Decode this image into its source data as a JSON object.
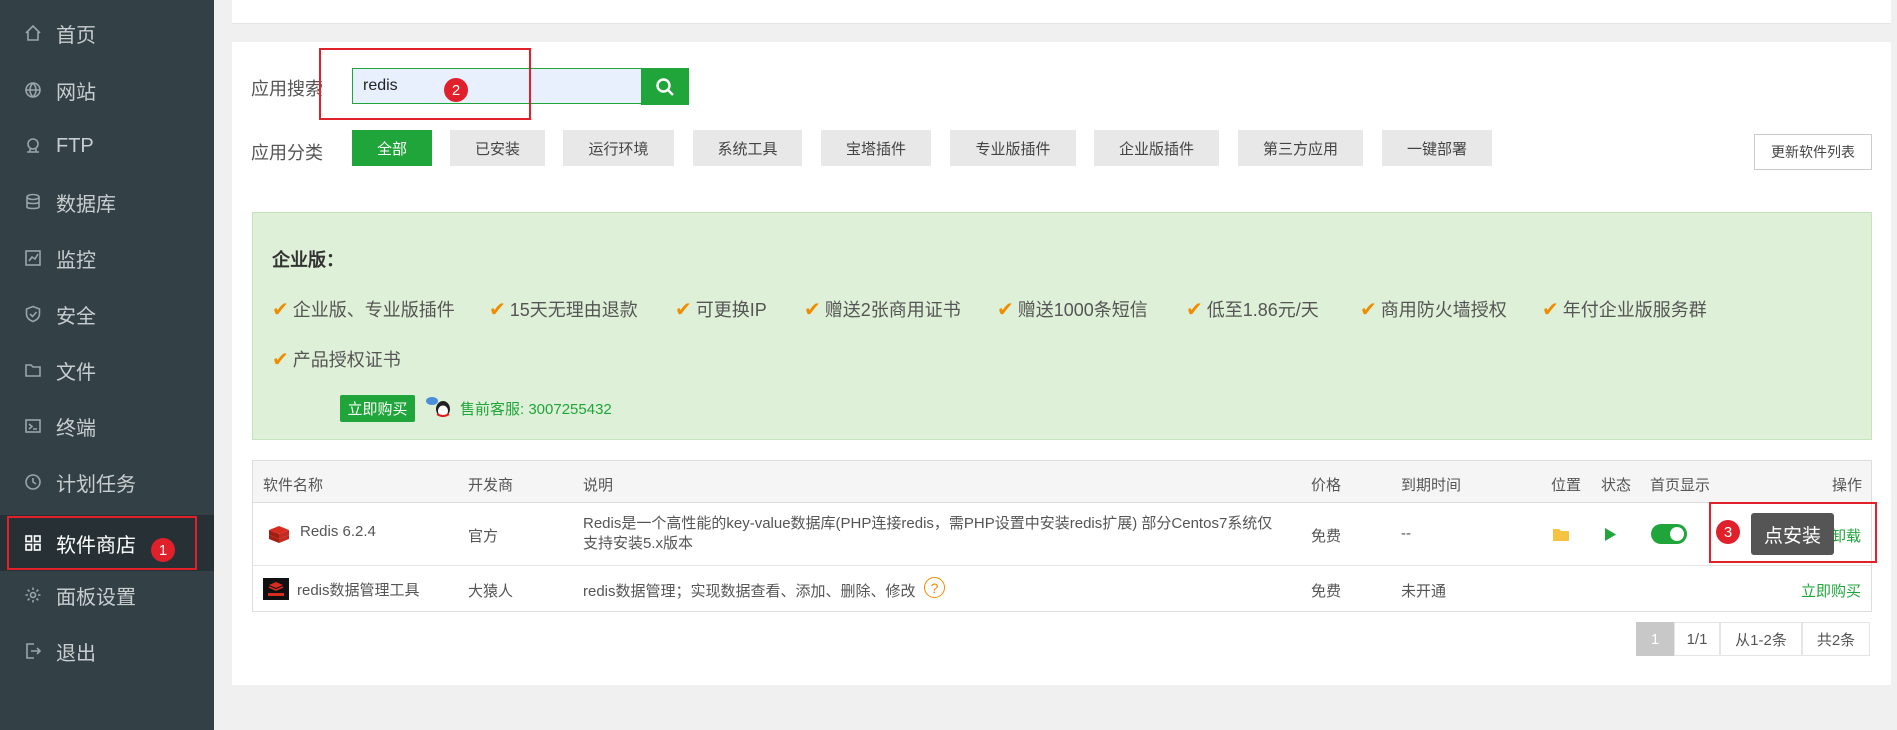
{
  "sidebar": {
    "items": [
      {
        "label": "首页",
        "icon": "home-icon"
      },
      {
        "label": "网站",
        "icon": "globe-icon"
      },
      {
        "label": "FTP",
        "icon": "ftp-icon"
      },
      {
        "label": "数据库",
        "icon": "database-icon"
      },
      {
        "label": "监控",
        "icon": "monitor-icon"
      },
      {
        "label": "安全",
        "icon": "shield-icon"
      },
      {
        "label": "文件",
        "icon": "folder-icon"
      },
      {
        "label": "终端",
        "icon": "terminal-icon"
      },
      {
        "label": "计划任务",
        "icon": "clock-icon"
      },
      {
        "label": "软件商店",
        "icon": "grid-icon"
      },
      {
        "label": "面板设置",
        "icon": "gear-icon"
      },
      {
        "label": "退出",
        "icon": "logout-icon"
      }
    ],
    "active_index": 9
  },
  "annotations": [
    "1",
    "2",
    "3"
  ],
  "search": {
    "label": "应用搜索",
    "value": "redis"
  },
  "categories": {
    "label": "应用分类",
    "items": [
      "全部",
      "已安装",
      "运行环境",
      "系统工具",
      "宝塔插件",
      "专业版插件",
      "企业版插件",
      "第三方应用",
      "一键部署"
    ],
    "refresh_label": "更新软件列表"
  },
  "banner": {
    "title": "企业版：",
    "features": [
      "企业版、专业版插件",
      "15天无理由退款",
      "可更换IP",
      "赠送2张商用证书",
      "赠送1000条短信",
      "低至1.86元/天",
      "商用防火墙授权",
      "年付企业版服务群",
      "产品授权证书"
    ],
    "buy_label": "立即购买",
    "presale_text": "售前客服: 3007255432"
  },
  "table": {
    "headers": [
      "软件名称",
      "开发商",
      "说明",
      "价格",
      "到期时间",
      "位置",
      "状态",
      "首页显示",
      "操作"
    ],
    "rows": [
      {
        "name": "Redis 6.2.4",
        "developer": "官方",
        "desc_line1": "Redis是一个高性能的key-value数据库(PHP连接redis，需PHP设置中安装redis扩展) 部分Centos7系统仅",
        "desc_line2": "支持安装5.x版本",
        "price": "免费",
        "expiry": "--",
        "action_uninstall": "卸载",
        "tooltip": "点安装"
      },
      {
        "name": "redis数据管理工具",
        "developer": "大猿人",
        "desc": "redis数据管理；实现数据查看、添加、删除、修改",
        "price": "免费",
        "expiry": "未开通",
        "action": "立即购买"
      }
    ]
  },
  "pagination": {
    "current": "1",
    "pages": "1/1",
    "range": "从1-2条",
    "total": "共2条"
  },
  "colors": {
    "accent": "#20a53a",
    "sidebar_bg": "#334046",
    "annotation": "#e0202a"
  }
}
